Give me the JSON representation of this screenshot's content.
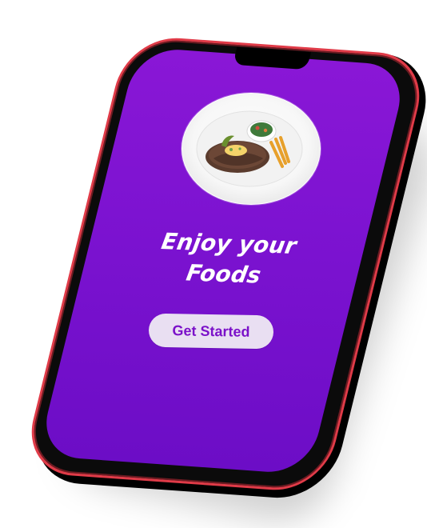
{
  "screen": {
    "headline_line1": "Enjoy your",
    "headline_line2": "Foods",
    "cta_label": "Get Started"
  },
  "colors": {
    "screen_top": "#8a17d6",
    "screen_bottom": "#6c0dc6",
    "frame_accent": "#e03b48",
    "button_bg": "#e9dff2",
    "button_text": "#7b11c9"
  }
}
